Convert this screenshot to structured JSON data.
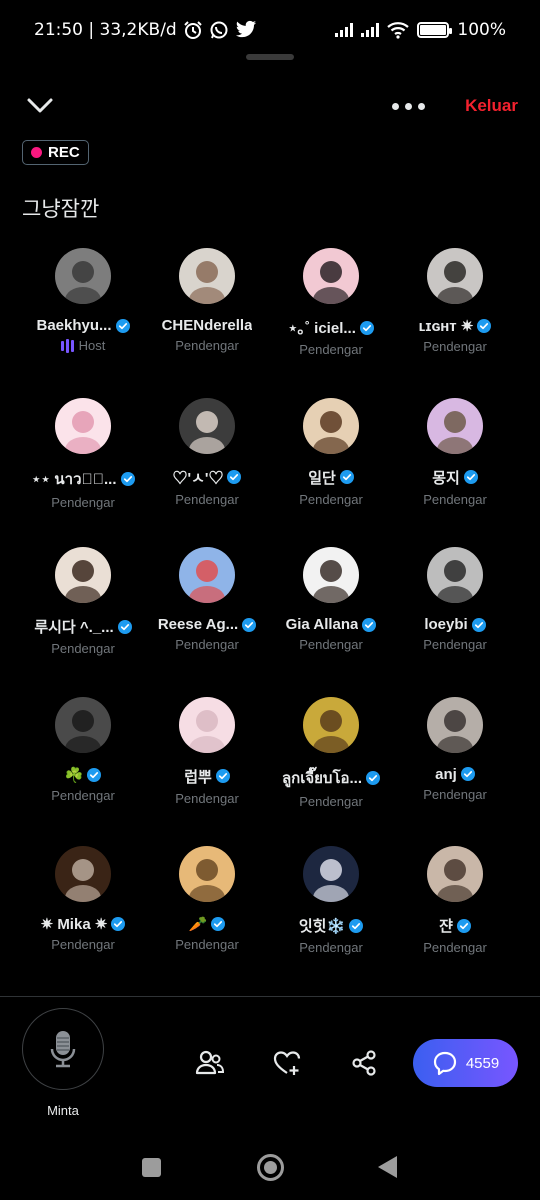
{
  "status_bar": {
    "time_and_speed": "21:50 | 33,2KB/d",
    "battery": "100%",
    "icons": [
      "alarm-icon",
      "whatsapp-icon",
      "twitter-icon",
      "signal-icon",
      "wifi-icon",
      "battery-icon"
    ]
  },
  "header": {
    "collapse_icon": "chevron-down-icon",
    "more_icon": "more-options-icon",
    "leave_label": "Keluar",
    "leave_color": "#f4212e"
  },
  "rec_badge": {
    "label": "REC",
    "dot_color": "#f91880"
  },
  "space": {
    "title": "그냥잠깐"
  },
  "participants": [
    {
      "name": "Baekhyu...",
      "role": "Host",
      "verified": true,
      "avatar_bg": "#7d7d7d",
      "avatar_fg": "#3a3a3a"
    },
    {
      "name": "CHENderella",
      "role": "Pendengar",
      "verified": false,
      "avatar_bg": "#d9d4cd",
      "avatar_fg": "#8a6b57"
    },
    {
      "name": "⋆｡˚ iciel...",
      "role": "Pendengar",
      "verified": true,
      "avatar_bg": "#f2c9d3",
      "avatar_fg": "#2b2226"
    },
    {
      "name": "ʟɪɢʜᴛ ✷",
      "role": "Pendengar",
      "verified": true,
      "avatar_bg": "#c9c6c4",
      "avatar_fg": "#2d2a28"
    },
    {
      "name": "⋆⋆ นาว�ึ...",
      "role": "Pendengar",
      "verified": true,
      "avatar_bg": "#fbe3ea",
      "avatar_fg": "#e39ab2"
    },
    {
      "name": "♡'ㅅ'♡",
      "role": "Pendengar",
      "verified": true,
      "avatar_bg": "#3c3c3c",
      "avatar_fg": "#d9cfc7"
    },
    {
      "name": "일단",
      "role": "Pendengar",
      "verified": true,
      "avatar_bg": "#e6d0b4",
      "avatar_fg": "#5a3a22"
    },
    {
      "name": "몽지",
      "role": "Pendengar",
      "verified": true,
      "avatar_bg": "#d8b8e2",
      "avatar_fg": "#6f5a4a"
    },
    {
      "name": "루시다 ^._...",
      "role": "Pendengar",
      "verified": true,
      "avatar_bg": "#eadfd5",
      "avatar_fg": "#3c2a20"
    },
    {
      "name": "Reese Ag...",
      "role": "Pendengar",
      "verified": true,
      "avatar_bg": "#8fb4e8",
      "avatar_fg": "#e05050"
    },
    {
      "name": "Gia Allana",
      "role": "Pendengar",
      "verified": true,
      "avatar_bg": "#f2f2f2",
      "avatar_fg": "#3a2f2a"
    },
    {
      "name": "loeybi",
      "role": "Pendengar",
      "verified": true,
      "avatar_bg": "#bdbdbd",
      "avatar_fg": "#2a2a2a"
    },
    {
      "name": "☘️",
      "role": "Pendengar",
      "verified": true,
      "avatar_bg": "#4a4a4a",
      "avatar_fg": "#1a1a1a"
    },
    {
      "name": "럽뿌",
      "role": "Pendengar",
      "verified": true,
      "avatar_bg": "#f6dde4",
      "avatar_fg": "#d9b8c2"
    },
    {
      "name": "ลูกเจี๊ยบโอ...",
      "role": "Pendengar",
      "verified": true,
      "avatar_bg": "#c9a93a",
      "avatar_fg": "#5a3d1c"
    },
    {
      "name": "anj",
      "role": "Pendengar",
      "verified": true,
      "avatar_bg": "#b5aea8",
      "avatar_fg": "#3a3432"
    },
    {
      "name": "✷ Mika ✷",
      "role": "Pendengar",
      "verified": true,
      "avatar_bg": "#3a2416",
      "avatar_fg": "#b9a89a"
    },
    {
      "name": "🥕",
      "role": "Pendengar",
      "verified": true,
      "avatar_bg": "#e7b978",
      "avatar_fg": "#6b4a25"
    },
    {
      "name": "잇힛❄️",
      "role": "Pendengar",
      "verified": true,
      "avatar_bg": "#1d2740",
      "avatar_fg": "#d8dbe6"
    },
    {
      "name": "쟌",
      "role": "Pendengar",
      "verified": true,
      "avatar_bg": "#c9b7a8",
      "avatar_fg": "#4a3a30"
    }
  ],
  "controls": {
    "mic_label": "Minta",
    "mic_icon": "microphone-icon",
    "people_icon": "people-icon",
    "react_icon": "heart-plus-icon",
    "share_icon": "share-icon",
    "chat_icon": "chat-bubble-icon",
    "chat_count": "4559",
    "chat_color": "#5b5ef6"
  },
  "navigation": {
    "icons": [
      "recents-square-icon",
      "home-circle-icon",
      "back-triangle-icon"
    ]
  }
}
